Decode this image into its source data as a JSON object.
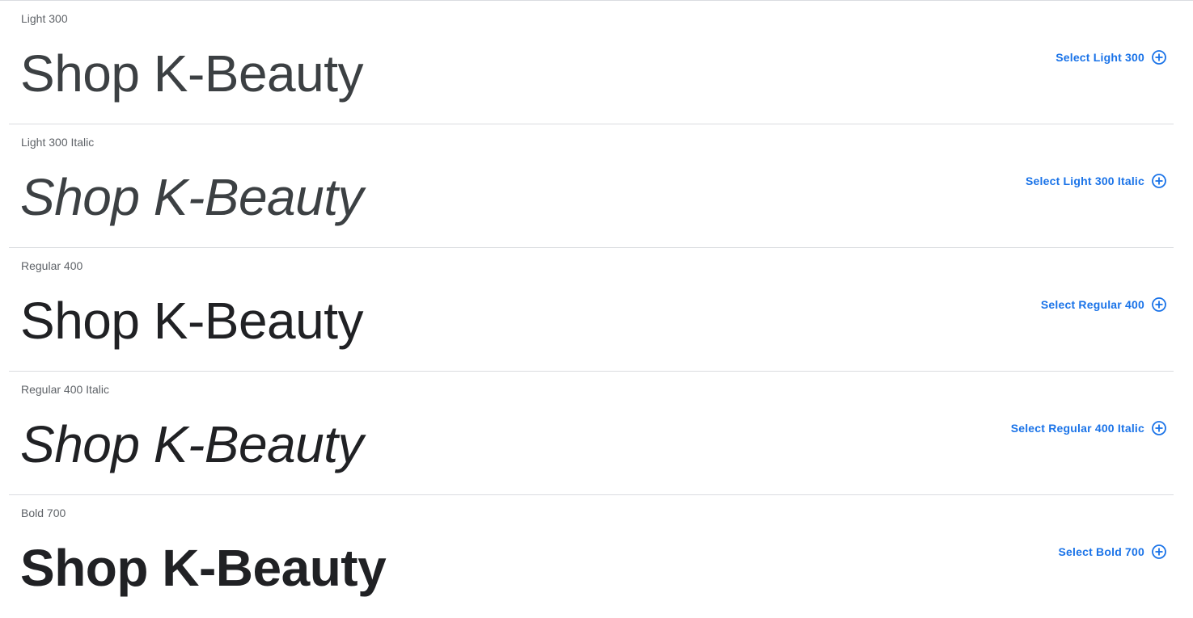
{
  "sample_text": "Shop K-Beauty",
  "accent_color": "#1a73e8",
  "styles": [
    {
      "label": "Light 300",
      "select_label": "Select Light 300"
    },
    {
      "label": "Light 300 Italic",
      "select_label": "Select Light 300 Italic"
    },
    {
      "label": "Regular 400",
      "select_label": "Select Regular 400"
    },
    {
      "label": "Regular 400 Italic",
      "select_label": "Select Regular 400 Italic"
    },
    {
      "label": "Bold 700",
      "select_label": "Select Bold 700"
    }
  ],
  "icons": {
    "select": "add-circle-icon"
  }
}
